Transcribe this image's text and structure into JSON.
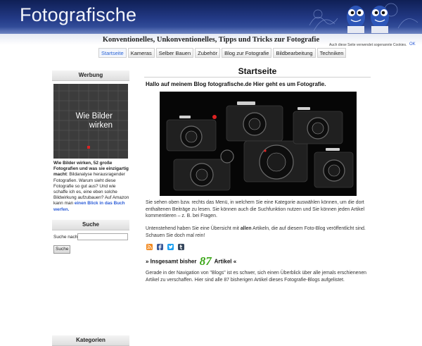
{
  "header": {
    "logo": "Fotografische",
    "tagline": "Konventionelles, Unkonventionelles, Tipps und Tricks zur Fotografie",
    "cookie_notice": "Auch diese Seite verwendet sogenannte Cookies.",
    "cookie_ok": "OK"
  },
  "nav": {
    "tabs": [
      {
        "label": "Startseite",
        "active": true
      },
      {
        "label": "Kameras"
      },
      {
        "label": "Selber Bauen"
      },
      {
        "label": "Zubehör"
      },
      {
        "label": "Blog zur Fotografie"
      },
      {
        "label": "Bildbearbeitung"
      },
      {
        "label": "Techniken"
      }
    ]
  },
  "sidebar": {
    "ad_heading": "Werbung",
    "book": {
      "title_line1": "Wie Bilder",
      "title_line2": "wirken"
    },
    "ad_text_bold": "Wie Bilder wirken, 52 große Fotografien und was sie einzigartig macht",
    "ad_text_body": ": Bildanalyse herausragender Fotografien. Warum sieht diese Fotografie so gut aus? Und wie schaffe ich es, eine eben solche Bildwirkung aufzubauen? Auf Amazon kann man ",
    "ad_link": "einen Blick in das Buch werfen.",
    "search_heading": "Suche",
    "search_label": "Suche nach:",
    "search_value": "",
    "search_button": "Suche",
    "categories_heading": "Kategorien"
  },
  "main": {
    "title": "Startseite",
    "greeting": "Hallo auf meinem Blog fotografische.de Hier geht es um Fotografie.",
    "para1": "Sie sehen oben bzw. rechts das Menü, in welchem Sie eine Kategorie auswählen können, um die dort enthaltenen Beiträge zu lesen. Sie können auch die Suchfunktion nutzen und Sie können jeden Artikel kommentieren – z. B. bei Fragen.",
    "para2_pre": "Untenstehend haben Sie eine Übersicht mit ",
    "para2_bold": "allen",
    "para2_post": " Artikeln, die auf diesem Foto-Blog veröffentlicht sind. Schauen Sie doch mal rein!",
    "count_prefix": "» Insgesamt bisher ",
    "count_number": "87",
    "count_suffix": " Artikel «",
    "para3": "Gerade in der Navigation von \"Blogs\" ist es schwer, sich einen Überblick über alle jemals erschienenen Artikel zu verschaffen. Hier sind alle 87 bisherigen Artikel dieses Fotografie-Blogs aufgelistet."
  },
  "social": {
    "icons": [
      "rss-icon",
      "facebook-icon",
      "twitter-icon",
      "tumblr-icon"
    ],
    "colors": {
      "rss": "#f2891f",
      "facebook": "#3b5998",
      "twitter": "#1da1f2",
      "tumblr": "#35465c"
    }
  },
  "colors": {
    "header_dark": "#0f1f55",
    "header_light": "#3d5aa8",
    "link": "#2a5bd7",
    "count_green": "#3aa617",
    "active_tab": "#2a64d6"
  }
}
